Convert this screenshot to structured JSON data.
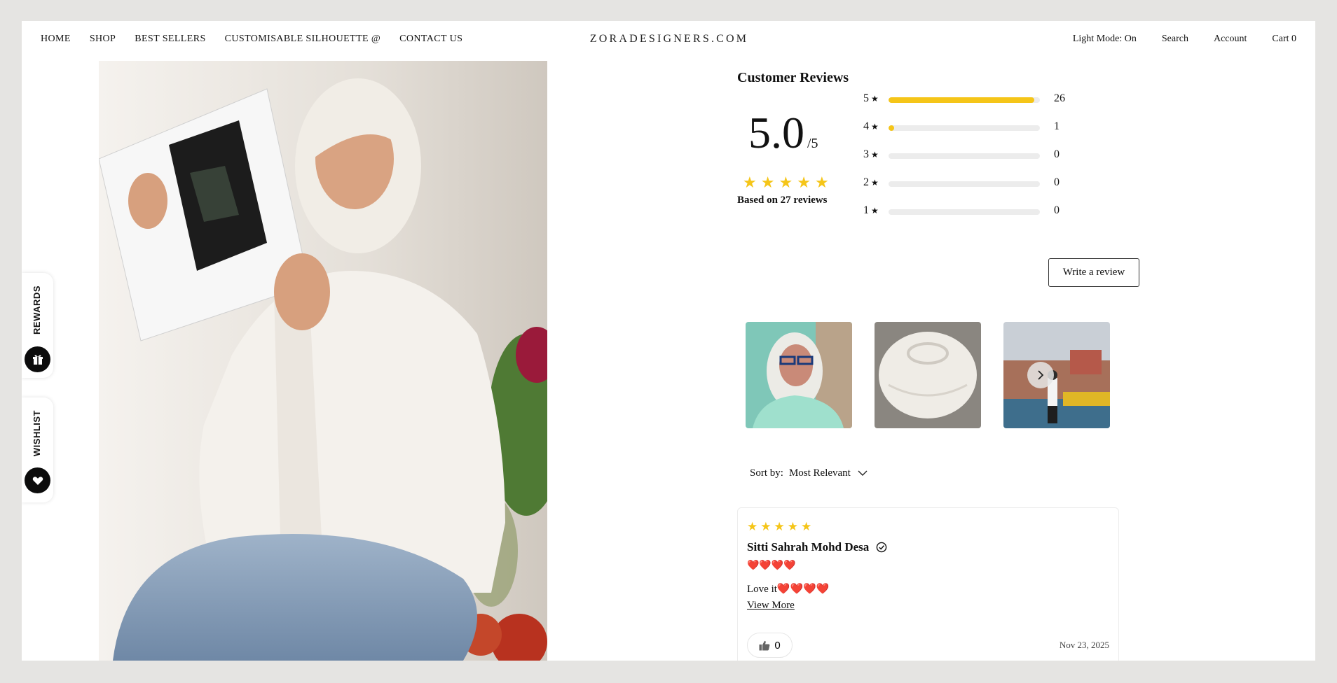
{
  "nav": {
    "items": [
      "HOME",
      "SHOP",
      "BEST SELLERS",
      "CUSTOMISABLE SILHOUETTE @",
      "CONTACT US"
    ]
  },
  "logo": "ZORADESIGNERS.COM",
  "right_nav": {
    "light_mode": "Light Mode: On",
    "search": "Search",
    "account": "Account",
    "cart": "Cart 0"
  },
  "side_tabs": {
    "rewards": "REWARDS",
    "wishlist": "WISHLIST"
  },
  "reviews": {
    "title": "Customer Reviews",
    "score": "5.0",
    "score_suffix": "/5",
    "stars": 5,
    "based_on": "Based on 27 reviews",
    "distribution": [
      {
        "stars": "5",
        "count": "26",
        "fraction": 0.963
      },
      {
        "stars": "4",
        "count": "1",
        "fraction": 0.037
      },
      {
        "stars": "3",
        "count": "0",
        "fraction": 0
      },
      {
        "stars": "2",
        "count": "0",
        "fraction": 0
      },
      {
        "stars": "1",
        "count": "0",
        "fraction": 0
      }
    ],
    "write_button": "Write a review",
    "sort_label": "Sort by:",
    "sort_value": "Most Relevant"
  },
  "review_card": {
    "rating": 5,
    "author": "Sitti Sahrah Mohd Desa",
    "hearts": "❤️❤️❤️❤️",
    "text": "Love it",
    "text_hearts": "❤️❤️❤️❤️",
    "view_more": "View More",
    "likes": "0",
    "date": "Nov 23, 2025"
  },
  "colors": {
    "accent_star": "#f5c518",
    "heart": "#e11b22"
  }
}
